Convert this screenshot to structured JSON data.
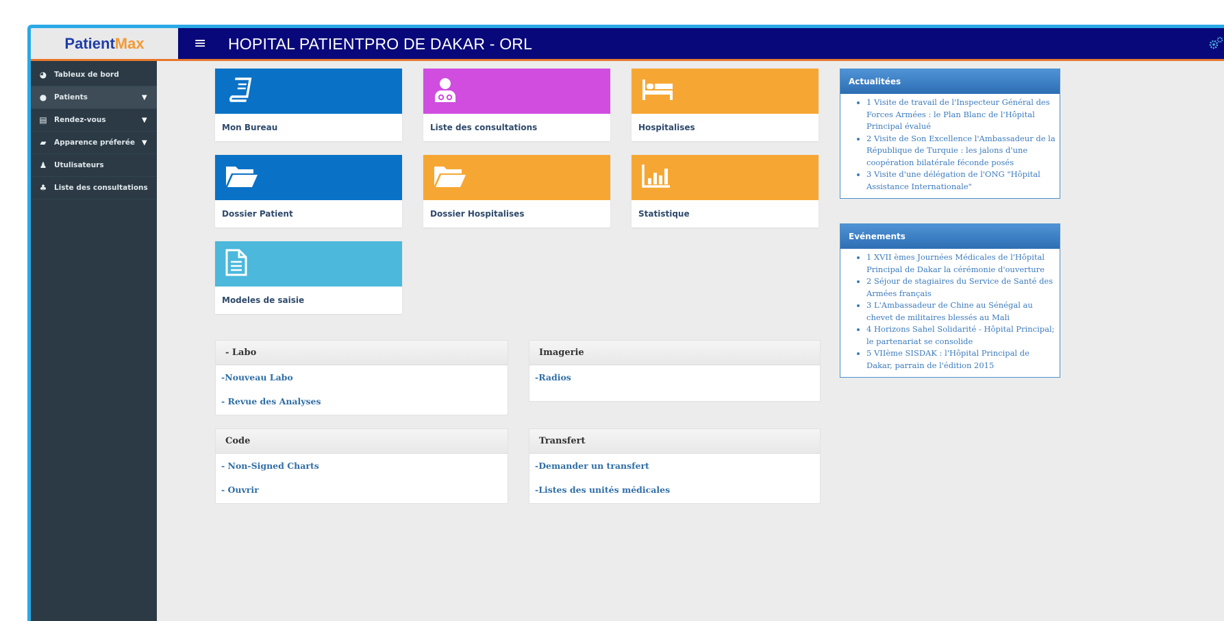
{
  "brand": {
    "part1": "Patient",
    "part2": "Max"
  },
  "header": {
    "menu_glyph": "≡",
    "title": "HOPITAL PATIENTPRO DE DAKAR - ORL",
    "settings_icon": "gears-icon"
  },
  "sidebar": {
    "items": [
      {
        "label": "Tableux de bord",
        "icon": "dashboard-icon",
        "chevron": false
      },
      {
        "label": "Patients",
        "icon": "info-icon",
        "chevron": true
      },
      {
        "label": "Rendez-vous",
        "icon": "calendar-icon",
        "chevron": true
      },
      {
        "label": "Apparence préferée",
        "icon": "car-icon",
        "chevron": true
      },
      {
        "label": "Utulisateurs",
        "icon": "user-icon",
        "chevron": false
      },
      {
        "label": "Liste des consultations",
        "icon": "users-icon",
        "chevron": false
      }
    ]
  },
  "tiles": [
    {
      "label": "Mon Bureau",
      "icon": "book-icon",
      "color": "#0a72c6"
    },
    {
      "label": "Liste des consultations",
      "icon": "doctor-icon",
      "color": "#d04de0"
    },
    {
      "label": "Hospitalises",
      "icon": "bed-icon",
      "color": "#f6a733"
    },
    {
      "label": "Dossier Patient",
      "icon": "folder-open-icon",
      "color": "#0a72c6"
    },
    {
      "label": "Dossier Hospitalises",
      "icon": "folder-open-icon",
      "color": "#f6a733"
    },
    {
      "label": "Statistique",
      "icon": "bar-chart-icon",
      "color": "#f6a733"
    },
    {
      "label": "Modeles de saisie",
      "icon": "document-icon",
      "color": "#4bb8dc"
    }
  ],
  "panels": {
    "labo": {
      "title": "- Labo",
      "links": [
        "-Nouveau Labo",
        "- Revue des Analyses"
      ]
    },
    "imagerie": {
      "title": "Imagerie",
      "links": [
        "-Radios"
      ]
    },
    "code": {
      "title": "Code",
      "links": [
        "- Non-Signed Charts",
        "- Ouvrir"
      ]
    },
    "transfert": {
      "title": "Transfert",
      "links": [
        "-Demander un transfert",
        "-Listes des unités médicales"
      ]
    }
  },
  "news": {
    "title": "Actualitées",
    "items": [
      "1 Visite de travail de l'Inspecteur Général des Forces Armées : le Plan Blanc de l'Hôpital Principal évalué",
      "2 Visite de Son Excellence l'Ambassadeur de la République de Turquie : les jalons d'une coopération bilatérale féconde posés",
      "3 Visite d'une délégation de l'ONG \"Hôpital Assistance Internationale\""
    ]
  },
  "events": {
    "title": "Evénements",
    "items": [
      "1 XVII èmes Journées Médicales de l'Hôpital Principal de Dakar la cérémonie d'ouverture",
      "2 Séjour de stagiaires du Service de Santé des Armées français",
      "3 L'Ambassadeur de Chine au Sénégal au chevet de militaires blessés au Mali",
      "4 Horizons Sahel Solidarité - Hôpital Principal; le partenariat se consolide",
      "5 VIIème SISDAK : l'Hôpital Principal de Dakar, parrain de l'édition 2015"
    ]
  }
}
